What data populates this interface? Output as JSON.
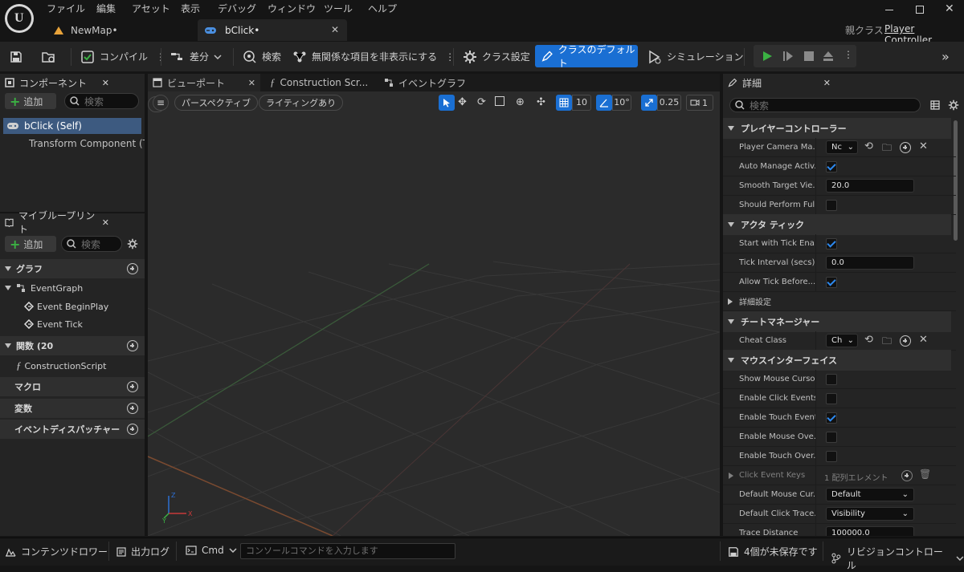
{
  "menu": [
    "ファイル",
    "編集",
    "アセット",
    "表示",
    "デバッグ",
    "ウィンドウ",
    "ツール",
    "ヘルプ"
  ],
  "tabs": [
    {
      "label": "NewMap•"
    },
    {
      "label": "bClick•"
    }
  ],
  "parent_class": {
    "label": "親クラス",
    "value": "Player Controller"
  },
  "toolbar": {
    "compile": "コンパイル",
    "diff": "差分",
    "search": "検索",
    "hide_unrelated": "無関係な項目を非表示にする",
    "class_settings": "クラス設定",
    "class_defaults": "クラスのデフォルト",
    "simulation": "シミュレーション"
  },
  "components": {
    "tab": "コンポーネント",
    "add": "追加",
    "search_placeholder": "検索",
    "items": [
      "bClick (Self)",
      "Transform Component (T"
    ]
  },
  "my_blueprint": {
    "tab": "マイブループリント",
    "add": "追加",
    "search_placeholder": "検索",
    "graph_header": "グラフ",
    "event_graph": "EventGraph",
    "events": [
      "Event BeginPlay",
      "Event Tick"
    ],
    "functions_header": "関数 (20",
    "construction_script": "ConstructionScript",
    "macros": "マクロ",
    "variables": "変数",
    "dispatchers": "イベントディスパッチャー"
  },
  "viewport_tabs": [
    "ビューポート",
    "Construction Scr...",
    "イベントグラフ"
  ],
  "viewport": {
    "perspective": "パースペクティブ",
    "lighting": "ライティングあり",
    "grid": "10",
    "angle": "10°",
    "scale": "0.25",
    "camera": "1"
  },
  "details": {
    "tab": "詳細",
    "search_placeholder": "検索",
    "sections": {
      "player_controller": "プレイヤーコントローラー",
      "actor_tick": "アクタ ティック",
      "advanced": "詳細設定",
      "cheat_manager": "チートマネージャー",
      "mouse_interface": "マウスインターフェイス"
    },
    "props": {
      "camera_manager": "Player Camera Ma...",
      "camera_manager_val": "Nc",
      "auto_manage": "Auto Manage Activ...",
      "smooth_target": "Smooth Target Vie...",
      "smooth_target_val": "20.0",
      "should_perform": "Should Perform Ful...",
      "start_tick": "Start with Tick Ena...",
      "tick_interval": "Tick Interval (secs)",
      "tick_interval_val": "0.0",
      "allow_tick": "Allow Tick Before...",
      "cheat_class": "Cheat Class",
      "cheat_class_val": "Ch",
      "show_cursor": "Show Mouse Cursor",
      "click_events": "Enable Click Events",
      "touch_events": "Enable Touch Events",
      "mouse_over": "Enable Mouse Ove...",
      "touch_over": "Enable Touch Over...",
      "click_keys": "Click Event Keys",
      "click_keys_val": "1 配列エレメント",
      "mouse_cursor": "Default Mouse Cur...",
      "mouse_cursor_val": "Default",
      "click_trace": "Default Click Trace...",
      "click_trace_val": "Visibility",
      "trace_distance": "Trace Distance",
      "trace_distance_val": "100000.0"
    }
  },
  "status": {
    "content_drawer": "コンテンツドロワー",
    "output_log": "出力ログ",
    "cmd": "Cmd",
    "console_placeholder": "コンソールコマンドを入力します",
    "unsaved": "4個が未保存です",
    "revision": "リビジョンコントロール"
  },
  "colors": {
    "accent": "#1a6fd3",
    "play_green": "#3bb143",
    "bg_panel": "#242424",
    "bg_dark": "#151515"
  }
}
